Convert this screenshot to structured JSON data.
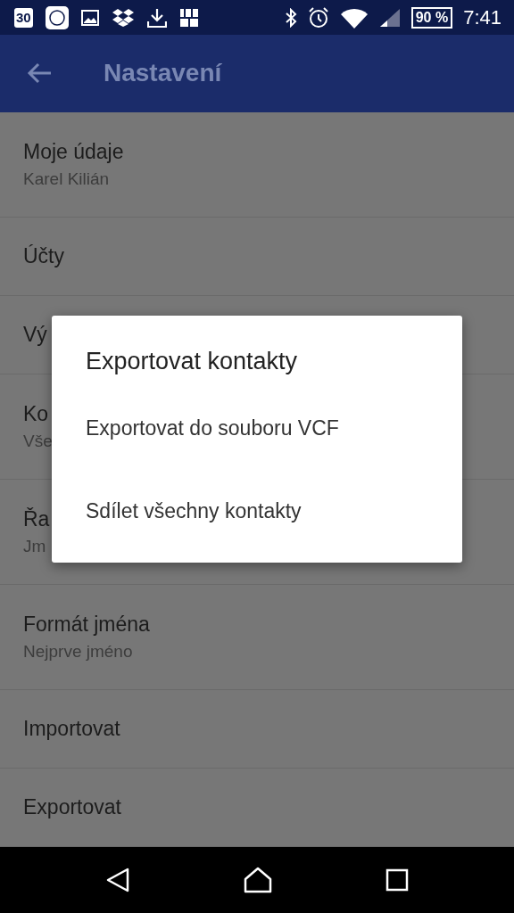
{
  "status_bar": {
    "calendar_day": "30",
    "battery": "90 %",
    "time": "7:41"
  },
  "app_bar": {
    "title": "Nastavení"
  },
  "settings": [
    {
      "title": "Moje údaje",
      "subtitle": "Karel Kilián"
    },
    {
      "title": "Účty"
    },
    {
      "title": "Vý"
    },
    {
      "title": "Ko",
      "subtitle": "Vše"
    },
    {
      "title": "Řa",
      "subtitle": "Jm"
    },
    {
      "title": "Formát jména",
      "subtitle": "Nejprve jméno"
    },
    {
      "title": "Importovat"
    },
    {
      "title": "Exportovat"
    }
  ],
  "dialog": {
    "title": "Exportovat kontakty",
    "options": [
      "Exportovat do souboru VCF",
      "Sdílet všechny kontakty"
    ]
  }
}
